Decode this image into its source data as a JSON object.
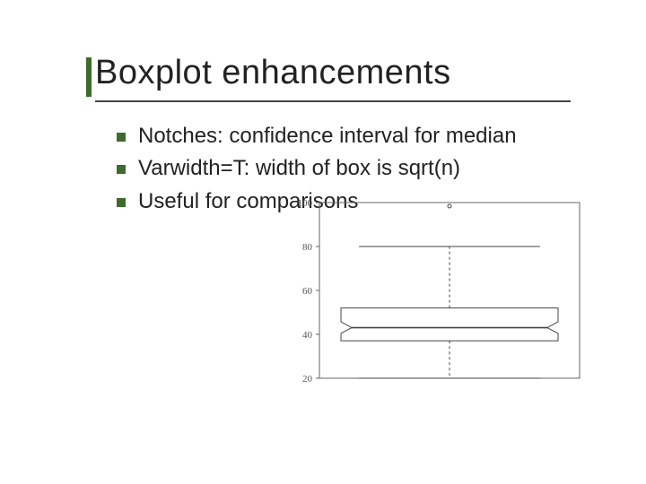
{
  "title": "Boxplot enhancements",
  "bullets": [
    "Notches: confidence interval for median",
    "Varwidth=T: width of box is sqrt(n)",
    "Useful for comparisons"
  ],
  "chart_data": {
    "type": "boxplot",
    "title": "",
    "xlabel": "",
    "ylabel": "",
    "ylim": [
      20,
      100
    ],
    "yticks": [
      20,
      40,
      60,
      80,
      100
    ],
    "series": [
      {
        "name": "",
        "min": 20,
        "q1": 37,
        "median": 43,
        "q3": 52,
        "max": 80,
        "outliers": [
          100
        ],
        "notched": true
      }
    ]
  }
}
